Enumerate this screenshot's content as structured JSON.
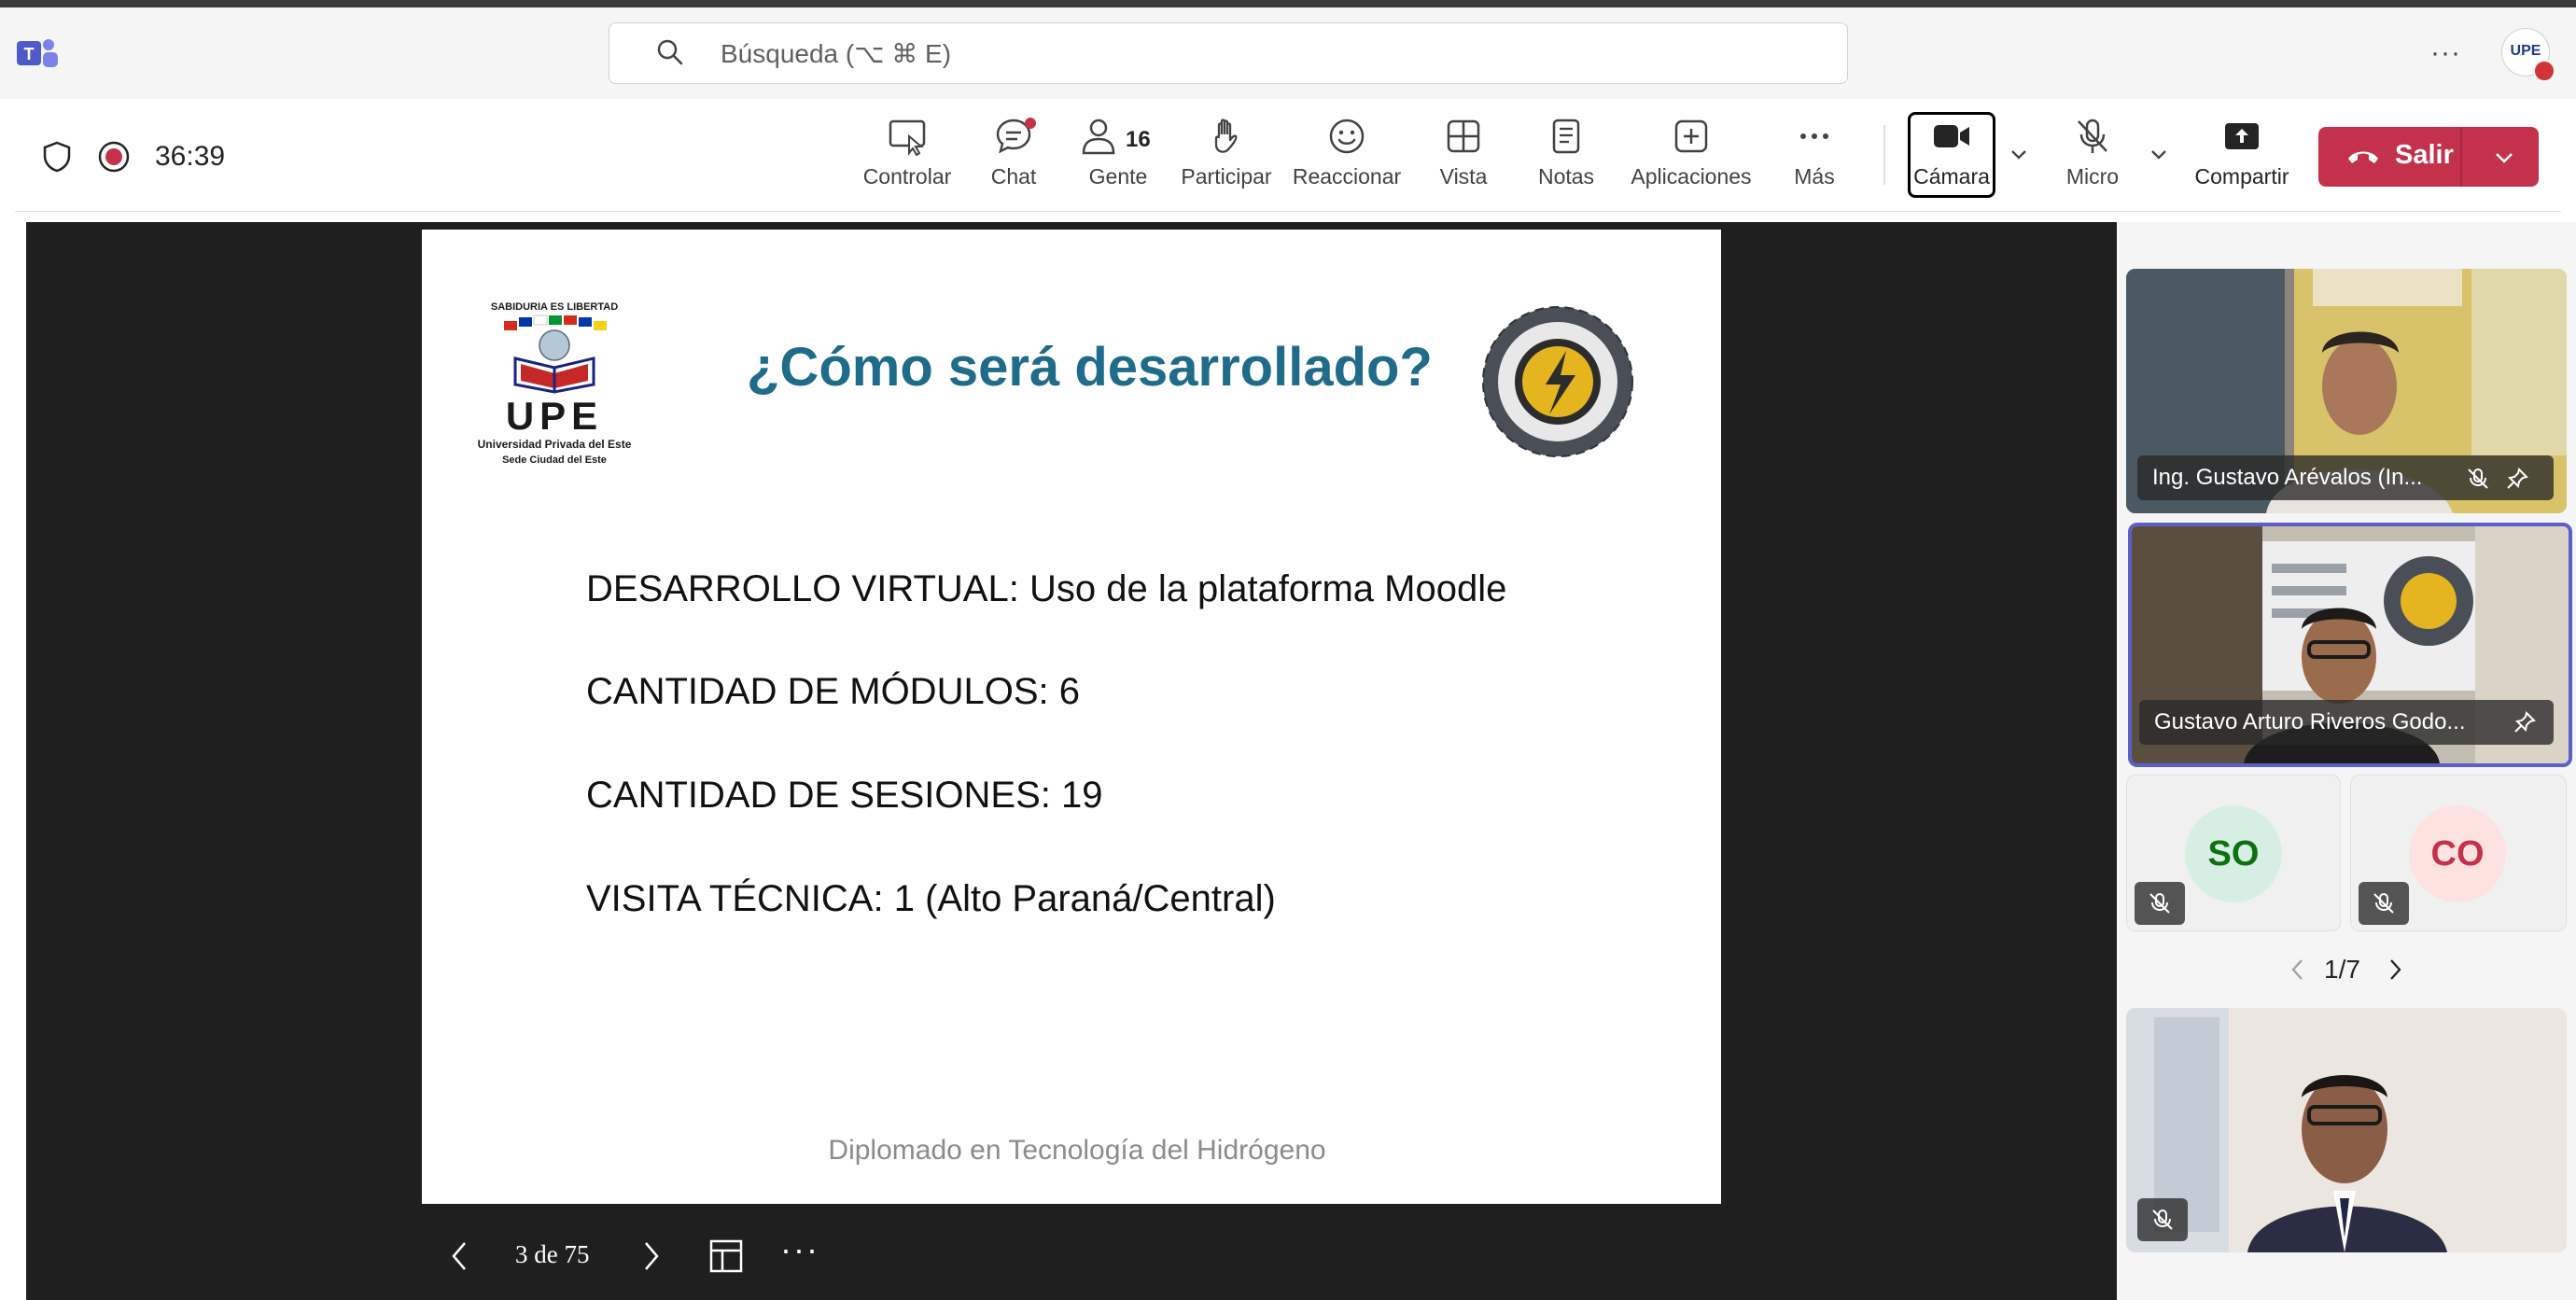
{
  "titlebar": {
    "search_placeholder": "Búsqueda (⌥ ⌘ E)",
    "more_label": "···",
    "avatar_text": "UPE"
  },
  "meeting": {
    "timer": "36:39",
    "toolbar": {
      "controlar": "Controlar",
      "chat": "Chat",
      "people_count": "16",
      "gente": "Gente",
      "participar": "Participar",
      "reaccionar": "Reaccionar",
      "vista": "Vista",
      "notas": "Notas",
      "aplicaciones": "Aplicaciones",
      "mas": "Más",
      "camara": "Cámara",
      "micro": "Micro",
      "compartir": "Compartir",
      "salir": "Salir"
    }
  },
  "slide": {
    "title": "¿Cómo será desarrollado?",
    "lines": [
      "DESARROLLO VIRTUAL: Uso de la plataforma Moodle",
      "CANTIDAD DE MÓDULOS: 6",
      "CANTIDAD DE SESIONES: 19",
      "VISITA TÉCNICA: 1 (Alto Paraná/Central)"
    ],
    "footer": "Diplomado en Tecnología del Hidrógeno",
    "logo_left": {
      "motto": "SABIDURIA ES LIBERTAD",
      "acronym": "UPE",
      "name": "Universidad Privada del Este",
      "campus": "Sede Ciudad del Este"
    }
  },
  "pdf_controls": {
    "page_indicator": "3 de 75",
    "more_label": "···"
  },
  "participants": {
    "tiles": [
      {
        "name": "Ing. Gustavo Arévalos (In..."
      },
      {
        "name": "Gustavo Arturo Riveros Godo..."
      },
      {
        "initials": "SO"
      },
      {
        "initials": "CO"
      }
    ],
    "pager": "1/7"
  },
  "colors": {
    "accent": "#5b5fc7",
    "leave": "#c4314b",
    "slide_title": "#1f6b8a",
    "stage": "#1f1f1f",
    "so_bg": "#d7efe3",
    "so_fg": "#0e700e",
    "co_bg": "#fde3df",
    "co_fg": "#c4314b"
  }
}
